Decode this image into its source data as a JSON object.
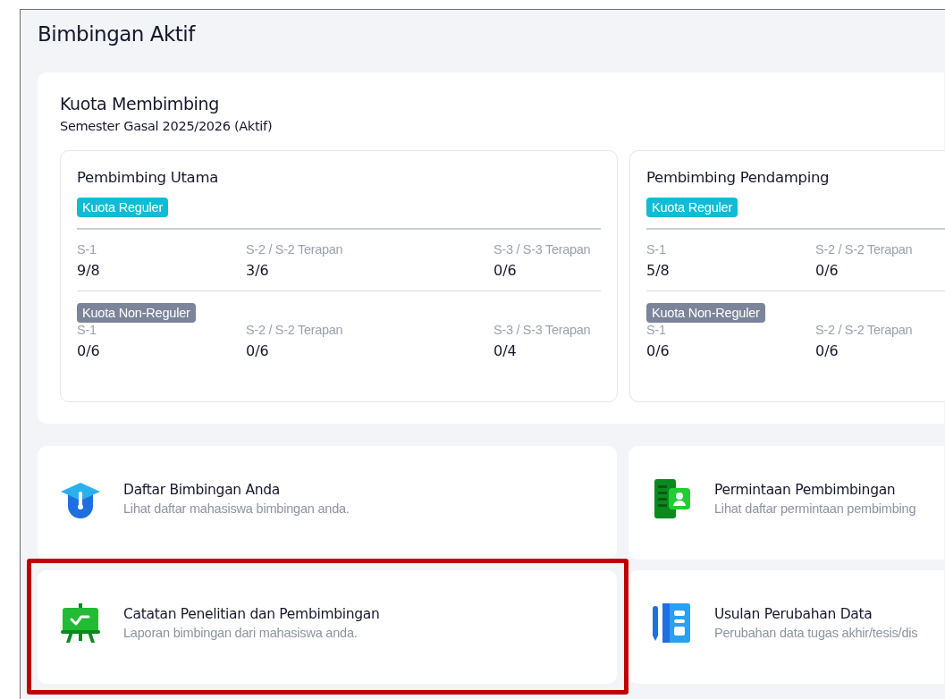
{
  "page": {
    "title": "Bimbingan Aktif"
  },
  "quota": {
    "title": "Kuota Membimbing",
    "subtitle": "Semester Gasal 2025/2026 (Aktif)",
    "groups": [
      {
        "title": "Pembimbing Utama",
        "sections": [
          {
            "badge": "Kuota Reguler",
            "kind": "reguler",
            "items": [
              {
                "label": "S-1",
                "value": "9/8"
              },
              {
                "label": "S-2 / S-2 Terapan",
                "value": "3/6"
              },
              {
                "label": "S-3 / S-3 Terapan",
                "value": "0/6"
              }
            ]
          },
          {
            "badge": "Kuota Non-Reguler",
            "kind": "non-reguler",
            "items": [
              {
                "label": "S-1",
                "value": "0/6"
              },
              {
                "label": "S-2 / S-2 Terapan",
                "value": "0/6"
              },
              {
                "label": "S-3 / S-3 Terapan",
                "value": "0/4"
              }
            ]
          }
        ]
      },
      {
        "title": "Pembimbing Pendamping",
        "sections": [
          {
            "badge": "Kuota Reguler",
            "kind": "reguler",
            "items": [
              {
                "label": "S-1",
                "value": "5/8"
              },
              {
                "label": "S-2 / S-2 Terapan",
                "value": "0/6"
              }
            ]
          },
          {
            "badge": "Kuota Non-Reguler",
            "kind": "non-reguler",
            "items": [
              {
                "label": "S-1",
                "value": "0/6"
              },
              {
                "label": "S-2 / S-2 Terapan",
                "value": "0/6"
              }
            ]
          }
        ]
      }
    ]
  },
  "menu": [
    {
      "kind": "cap",
      "title": "Daftar Bimbingan Anda",
      "description": "Lihat daftar mahasiswa bimbingan anda.",
      "highlighted": false
    },
    {
      "kind": "contact",
      "title": "Permintaan Pembimbingan",
      "description": "Lihat daftar permintaan pembimbing",
      "highlighted": false
    },
    {
      "kind": "easel",
      "title": "Catatan Penelitian dan Pembimbingan",
      "description": "Laporan bimbingan dari mahasiswa anda.",
      "highlighted": true
    },
    {
      "kind": "notebook",
      "title": "Usulan Perubahan Data",
      "description": "Perubahan data tugas akhir/tesis/dis",
      "highlighted": false
    }
  ]
}
